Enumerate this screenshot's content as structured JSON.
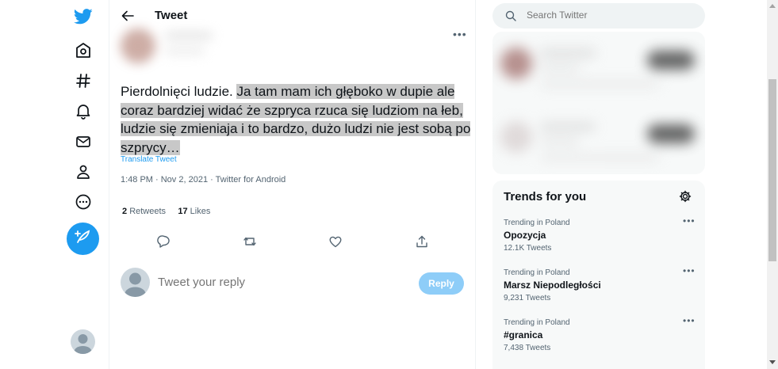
{
  "header": {
    "title": "Tweet"
  },
  "tweet": {
    "text_plain": "Pierdolnięci ludzie. ",
    "text_highlighted": "Ja tam mam ich głęboko w dupie ale coraz bardziej widać że szpryca rzuca się ludziom na łeb, ludzie się zmieniaja i to bardzo, dużo ludzi nie jest sobą po szprycy…",
    "translate_label": "Translate Tweet",
    "meta": "1:48 PM · Nov 2, 2021 · Twitter for Android",
    "retweets_count": "2",
    "retweets_label": "Retweets",
    "likes_count": "17",
    "likes_label": "Likes"
  },
  "reply": {
    "placeholder": "Tweet your reply",
    "button_label": "Reply"
  },
  "search": {
    "placeholder": "Search Twitter"
  },
  "trends": {
    "title": "Trends for you",
    "items": [
      {
        "context": "Trending in Poland",
        "name": "Opozycja",
        "count": "12.1K Tweets"
      },
      {
        "context": "Trending in Poland",
        "name": "Marsz Niepodległości",
        "count": "9,231 Tweets"
      },
      {
        "context": "Trending in Poland",
        "name": "#granica",
        "count": "7,438 Tweets"
      }
    ]
  },
  "colors": {
    "accent": "#1d9bf0",
    "highlight": "#c8c8c8",
    "reply_button_disabled": "#8ecdf8"
  },
  "icons": {
    "nav": [
      "twitter-logo-icon",
      "home-icon",
      "explore-hashtag-icon",
      "notifications-bell-icon",
      "messages-envelope-icon",
      "profile-person-icon",
      "more-circle-icon",
      "compose-tweet-icon"
    ],
    "actions": [
      "reply-icon",
      "retweet-icon",
      "like-heart-icon",
      "share-icon"
    ]
  }
}
